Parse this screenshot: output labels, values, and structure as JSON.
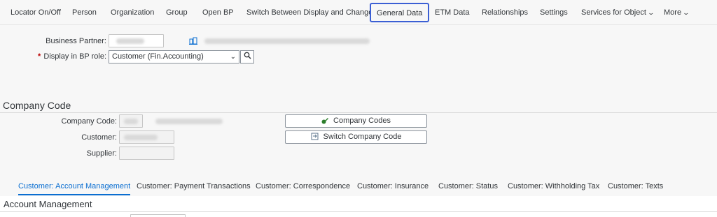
{
  "toolbar": {
    "items": [
      {
        "label": "Locator On/Off"
      },
      {
        "label": "Person"
      },
      {
        "label": "Organization"
      },
      {
        "label": "Group"
      },
      {
        "label": "Open BP"
      },
      {
        "label": "Switch Between Display and Change"
      },
      {
        "label": "General Data"
      },
      {
        "label": "ETM Data"
      },
      {
        "label": "Relationships"
      },
      {
        "label": "Settings"
      },
      {
        "label": "Services for Object"
      },
      {
        "label": "More"
      }
    ]
  },
  "header": {
    "bp_label": "Business Partner:",
    "role_label": "Display in BP role:",
    "role_value": "Customer (Fin.Accounting)"
  },
  "company_code_section": {
    "title": "Company Code",
    "company_code_label": "Company Code:",
    "customer_label": "Customer:",
    "supplier_label": "Supplier:",
    "company_codes_button": "Company Codes",
    "switch_button": "Switch Company Code"
  },
  "tabs": [
    {
      "label": "Customer: Account Management"
    },
    {
      "label": "Customer: Payment Transactions"
    },
    {
      "label": "Customer: Correspondence"
    },
    {
      "label": "Customer: Insurance"
    },
    {
      "label": "Customer: Status"
    },
    {
      "label": "Customer: Withholding Tax"
    },
    {
      "label": "Customer: Texts"
    }
  ],
  "account_section": {
    "title": "Account Management"
  },
  "colors": {
    "active_tab": "#0a6ed1",
    "highlight": "#3b5fd4",
    "required": "#bb0000"
  }
}
